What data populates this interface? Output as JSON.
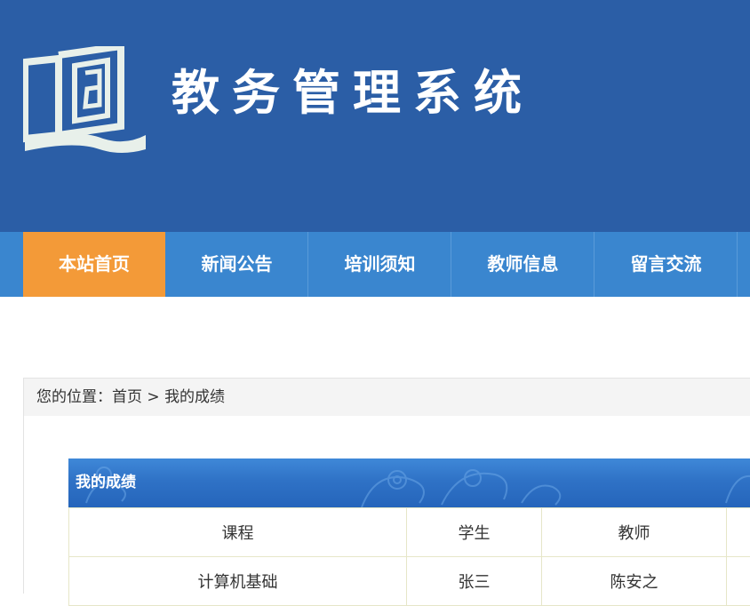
{
  "header": {
    "site_title": "教务管理系统"
  },
  "nav": {
    "items": [
      {
        "label": "本站首页",
        "active": true
      },
      {
        "label": "新闻公告",
        "active": false
      },
      {
        "label": "培训须知",
        "active": false
      },
      {
        "label": "教师信息",
        "active": false
      },
      {
        "label": "留言交流",
        "active": false
      }
    ]
  },
  "breadcrumb": {
    "prefix": "您的位置：",
    "home": "首页",
    "separator": " > ",
    "current": "我的成绩"
  },
  "grades": {
    "title": "我的成绩",
    "columns": [
      "课程",
      "学生",
      "教师"
    ],
    "rows": [
      [
        "计算机基础",
        "张三",
        "陈安之"
      ]
    ]
  },
  "colors": {
    "header_bg": "#2b5ea6",
    "nav_bg": "#3a86cf",
    "nav_active": "#f39a38"
  }
}
